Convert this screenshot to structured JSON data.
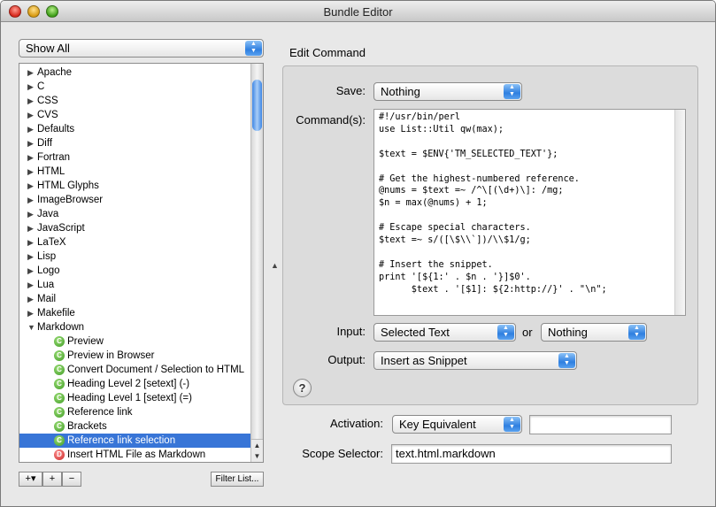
{
  "window": {
    "title": "Bundle Editor"
  },
  "sidebar": {
    "filter_popup": "Show All",
    "bundles": [
      {
        "label": "Apache",
        "expanded": false
      },
      {
        "label": "C",
        "expanded": false
      },
      {
        "label": "CSS",
        "expanded": false
      },
      {
        "label": "CVS",
        "expanded": false
      },
      {
        "label": "Defaults",
        "expanded": false
      },
      {
        "label": "Diff",
        "expanded": false
      },
      {
        "label": "Fortran",
        "expanded": false
      },
      {
        "label": "HTML",
        "expanded": false
      },
      {
        "label": "HTML Glyphs",
        "expanded": false
      },
      {
        "label": "ImageBrowser",
        "expanded": false
      },
      {
        "label": "Java",
        "expanded": false
      },
      {
        "label": "JavaScript",
        "expanded": false
      },
      {
        "label": "LaTeX",
        "expanded": false
      },
      {
        "label": "Lisp",
        "expanded": false
      },
      {
        "label": "Logo",
        "expanded": false
      },
      {
        "label": "Lua",
        "expanded": false
      },
      {
        "label": "Mail",
        "expanded": false
      },
      {
        "label": "Makefile",
        "expanded": false
      },
      {
        "label": "Markdown",
        "expanded": true
      }
    ],
    "markdown_items": [
      {
        "label": "Preview",
        "icon": "command-icon",
        "icon_color": "#3c9a22",
        "selected": false
      },
      {
        "label": "Preview in Browser",
        "icon": "command-icon",
        "icon_color": "#3c9a22",
        "selected": false
      },
      {
        "label": "Convert Document / Selection to HTML",
        "icon": "command-icon",
        "icon_color": "#3c9a22",
        "selected": false
      },
      {
        "label": "Heading Level 2 [setext] (-)",
        "icon": "command-icon",
        "icon_color": "#3c9a22",
        "selected": false
      },
      {
        "label": "Heading Level 1 [setext] (=)",
        "icon": "command-icon",
        "icon_color": "#3c9a22",
        "selected": false
      },
      {
        "label": "Reference link",
        "icon": "command-icon",
        "icon_color": "#3c9a22",
        "selected": false
      },
      {
        "label": "Brackets",
        "icon": "command-icon",
        "icon_color": "#3c9a22",
        "selected": false
      },
      {
        "label": "Reference link selection",
        "icon": "command-icon",
        "icon_color": "#3c9a22",
        "selected": true
      },
      {
        "label": "Insert HTML File as Markdown",
        "icon": "drag-command-icon",
        "icon_color": "#cc2222",
        "selected": false
      }
    ],
    "add_button": "+▾",
    "add_item_button": "+",
    "remove_button": "−",
    "filter_button": "Filter List..."
  },
  "editor": {
    "heading": "Edit Command",
    "save_label": "Save:",
    "save_value": "Nothing",
    "command_label": "Command(s):",
    "command_lines": [
      "#!/usr/bin/perl",
      "use List::Util qw(max);",
      "",
      "$text = $ENV{'TM_SELECTED_TEXT'};",
      "",
      "# Get the highest-numbered reference.",
      "@nums = $text =~ /^\\[(\\d+)\\]: /mg;",
      "$n = max(@nums) + 1;",
      "",
      "# Escape special characters.",
      "$text =~ s/([\\$\\\\`])/\\\\$1/g;",
      "",
      "# Insert the snippet.",
      "print '[${1:' . $n . '}]$0'.",
      "      $text . '[$1]: ${2:http://}' . \"\\n\";"
    ],
    "input_label": "Input:",
    "input_value": "Selected Text",
    "or_label": "or",
    "input_fallback": "Nothing",
    "output_label": "Output:",
    "output_value": "Insert as Snippet",
    "help_label": "?",
    "activation_label": "Activation:",
    "activation_value": "Key Equivalent",
    "key_equivalent_value": "",
    "scope_label": "Scope Selector:",
    "scope_value": "text.html.markdown"
  },
  "colors": {
    "selection": "#3875d7",
    "popup_arrows": "#2f7fe0"
  }
}
